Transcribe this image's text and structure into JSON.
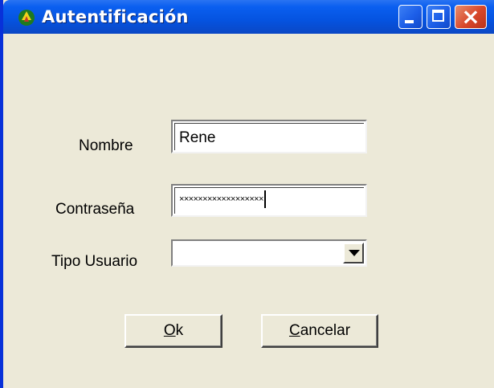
{
  "window": {
    "title": "Autentificación",
    "icon": "app-icon",
    "controls": {
      "minimize": "minimize-icon",
      "maximize": "maximize-icon",
      "close": "close-icon"
    }
  },
  "form": {
    "nombre": {
      "label": "Nombre",
      "value": "Rene"
    },
    "contrasena": {
      "label": "Contraseña",
      "value": "××××××××××××××××××"
    },
    "tipo_usuario": {
      "label": "Tipo Usuario",
      "value": ""
    }
  },
  "buttons": {
    "ok_mnemonic": "O",
    "ok_rest": "k",
    "cancel_mnemonic": "C",
    "cancel_rest": "ancelar"
  }
}
